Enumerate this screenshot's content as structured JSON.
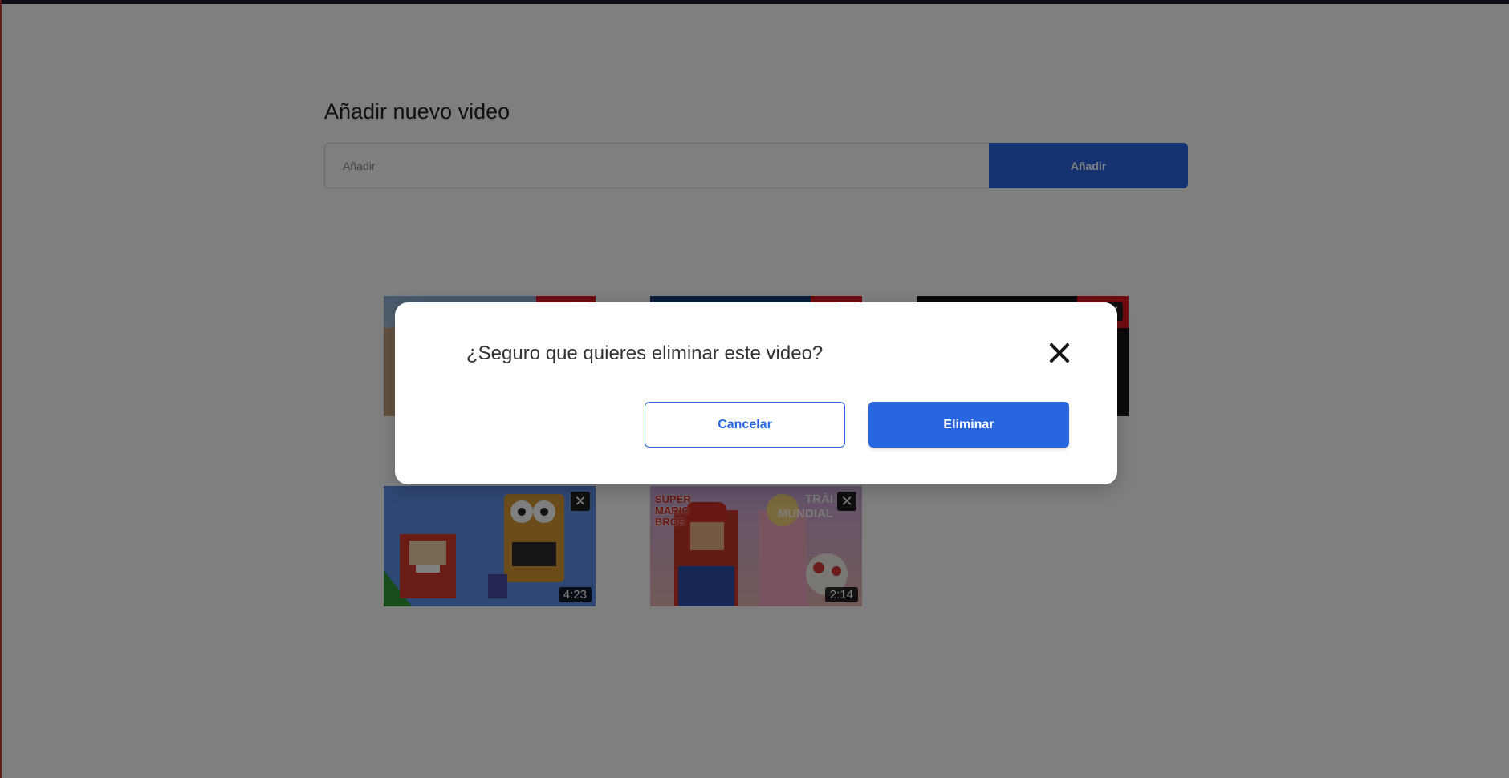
{
  "page": {
    "title": "Añadir nuevo video",
    "add_input_placeholder": "Añadir",
    "add_button_label": "Añadir"
  },
  "videos": [
    {
      "duration": "",
      "delete_label": "✕"
    },
    {
      "duration": "",
      "delete_label": "✕"
    },
    {
      "duration": "",
      "delete_label": "✕"
    },
    {
      "duration": "4:23",
      "delete_label": "✕"
    },
    {
      "duration": "2:14",
      "delete_label": "✕",
      "overlay_text": "TRÁI\nMUNDIAL",
      "logo_text": "SUPER\nMARIO\nBROS"
    }
  ],
  "modal": {
    "question": "¿Seguro que quieres eliminar este video?",
    "cancel_label": "Cancelar",
    "delete_label": "Eliminar",
    "close_icon": "close-icon"
  },
  "colors": {
    "accent": "#2866e0",
    "overlay": "rgba(0,0,0,0.5)"
  }
}
